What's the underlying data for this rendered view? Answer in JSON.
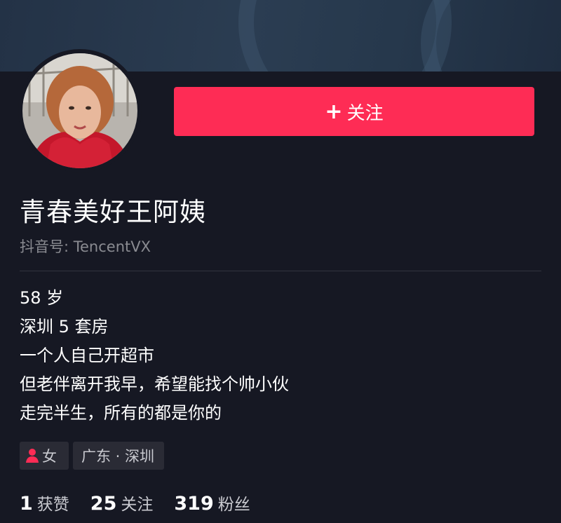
{
  "profile": {
    "nickname": "青春美好王阿姨",
    "douyin_id": "抖音号: TencentVX",
    "follow_button": {
      "plus": "+",
      "label": "关注"
    },
    "bio": [
      "58 岁",
      "深圳 5 套房",
      "一个人自己开超市",
      "但老伴离开我早，希望能找个帅小伙",
      "走完半生，所有的都是你的"
    ],
    "tags": {
      "gender": "女",
      "gender_icon": "female-user-icon",
      "location": "广东 · 深圳"
    },
    "stats": [
      {
        "count": "1",
        "label": "获赞"
      },
      {
        "count": "25",
        "label": "关注"
      },
      {
        "count": "319",
        "label": "粉丝"
      }
    ]
  },
  "colors": {
    "background": "#161823",
    "accent": "#fe2c55",
    "muted_text": "#8a8b91",
    "tag_background": "#2a2b35"
  }
}
